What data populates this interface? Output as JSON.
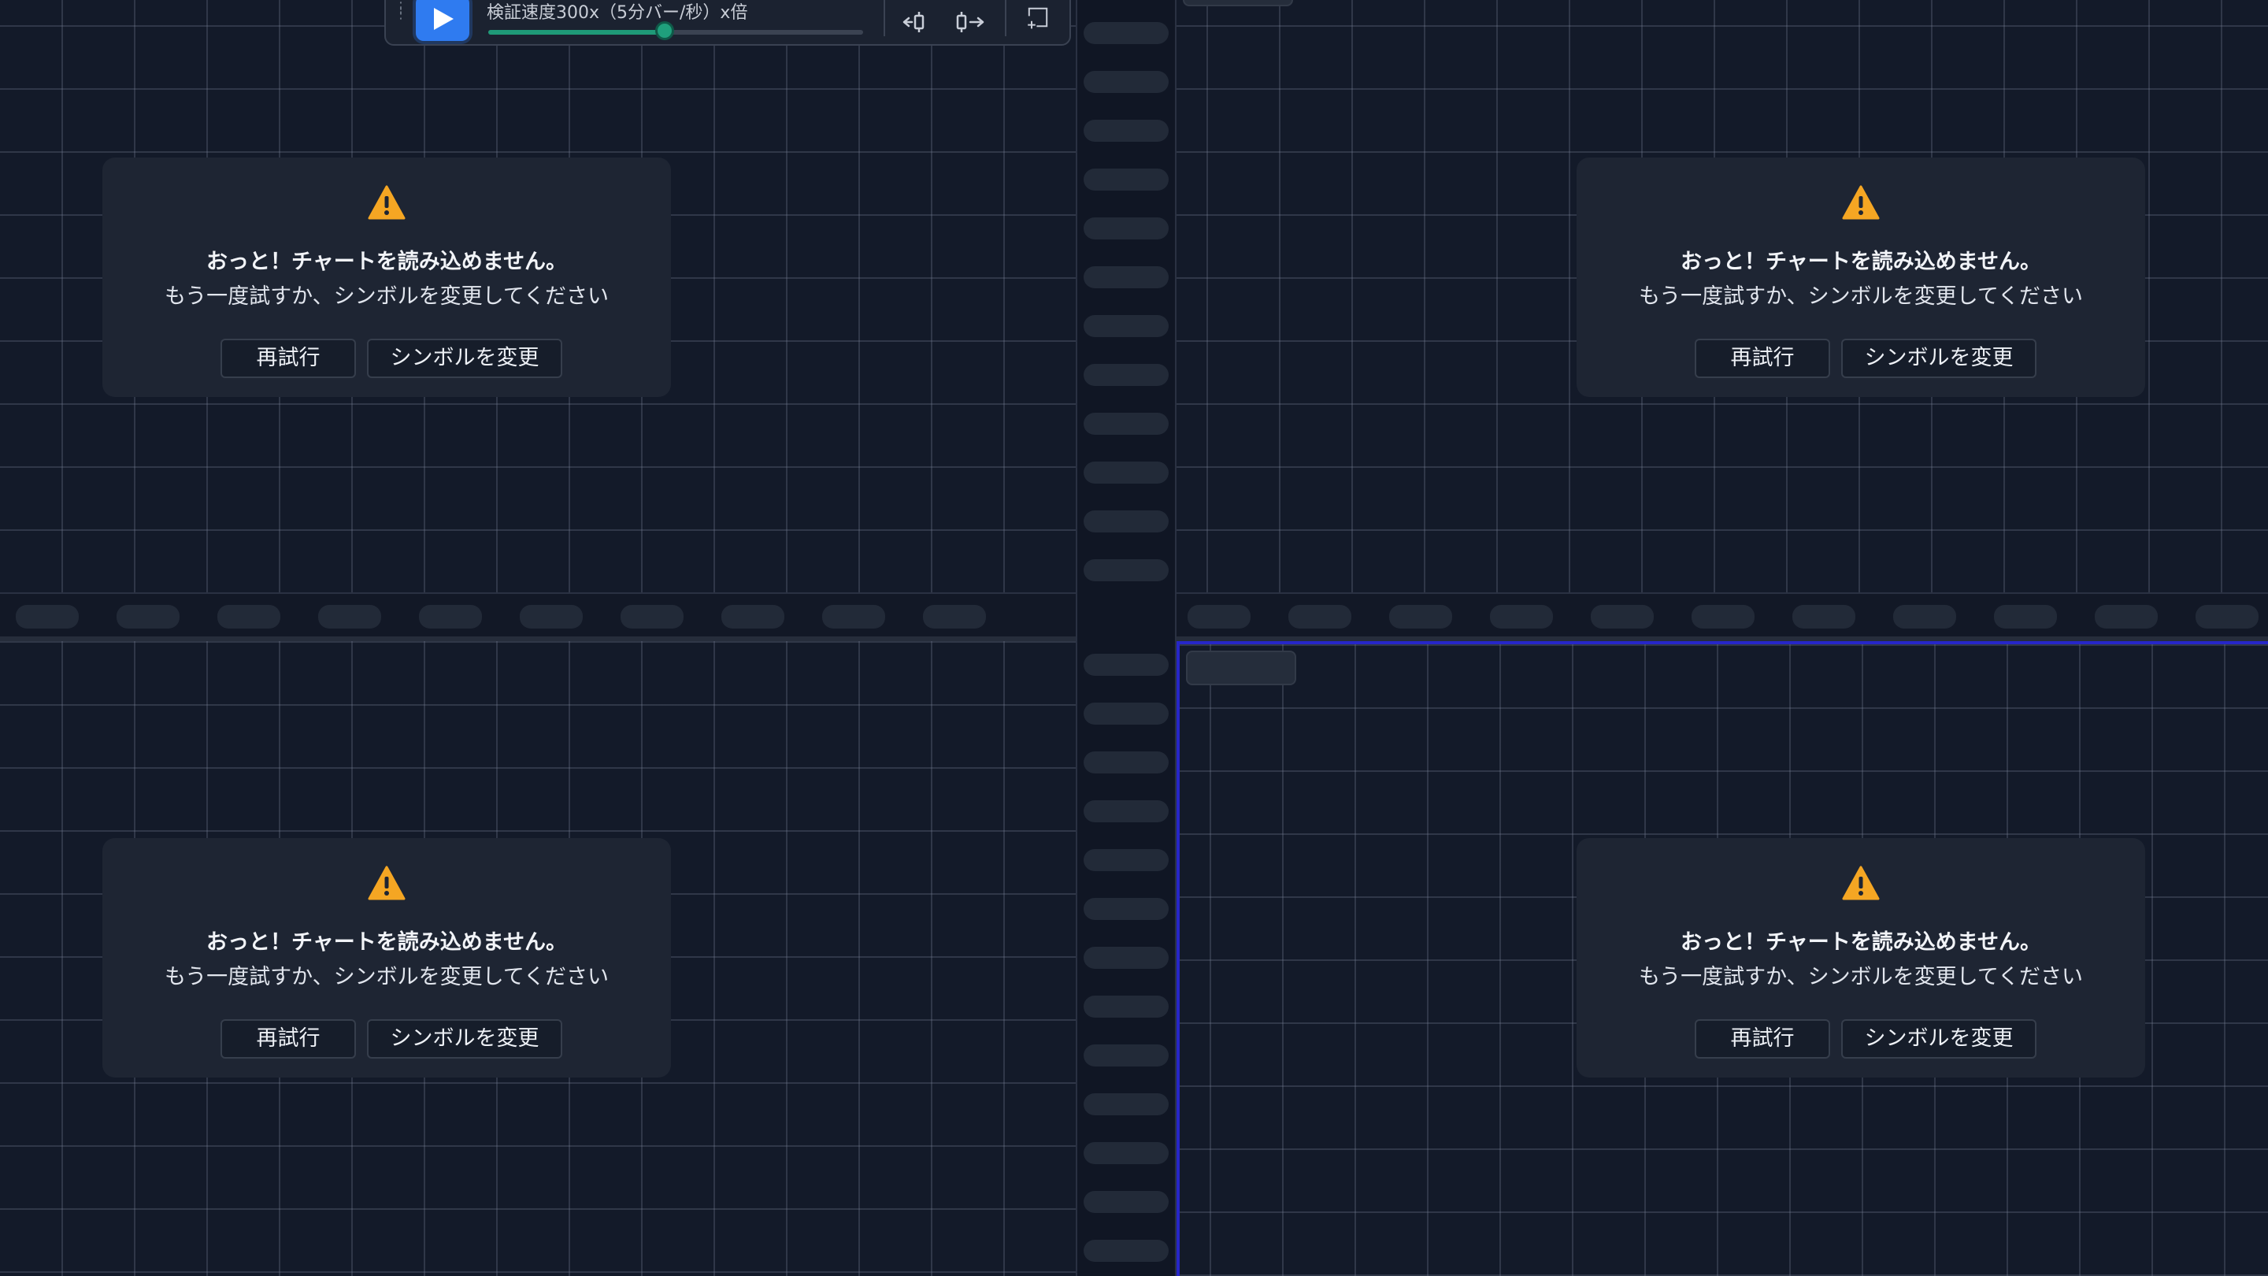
{
  "replay_toolbar": {
    "speed_label": "検証速度300x（5分バー/秒）x倍",
    "speed_progress": 0.47,
    "icons": [
      "drag-handle-icon",
      "play-icon",
      "step-back-icon",
      "step-forward-icon",
      "select-range-icon"
    ]
  },
  "panes": [
    {
      "id": "top-left",
      "error_title": "おっと！チャートを読み込めません。",
      "error_message": "もう一度試すか、シンボルを変更してください",
      "retry_label": "再試行",
      "change_symbol_label": "シンボルを変更"
    },
    {
      "id": "top-right",
      "error_title": "おっと！チャートを読み込めません。",
      "error_message": "もう一度試すか、シンボルを変更してください",
      "retry_label": "再試行",
      "change_symbol_label": "シンボルを変更"
    },
    {
      "id": "bottom-left",
      "error_title": "おっと！チャートを読み込めません。",
      "error_message": "もう一度試すか、シンボルを変更してください",
      "retry_label": "再試行",
      "change_symbol_label": "シンボルを変更"
    },
    {
      "id": "bottom-right",
      "active": true,
      "error_title": "おっと！チャートを読み込めません。",
      "error_message": "もう一度試すか、シンボルを変更してください",
      "retry_label": "再試行",
      "change_symbol_label": "シンボルを変更"
    }
  ],
  "colors": {
    "background": "#131a29",
    "card": "#1e2533",
    "warning": "#f5a623",
    "active_border": "#2626c8",
    "play_button": "#2f7bf0",
    "slider_fill": "#1f9a78"
  }
}
